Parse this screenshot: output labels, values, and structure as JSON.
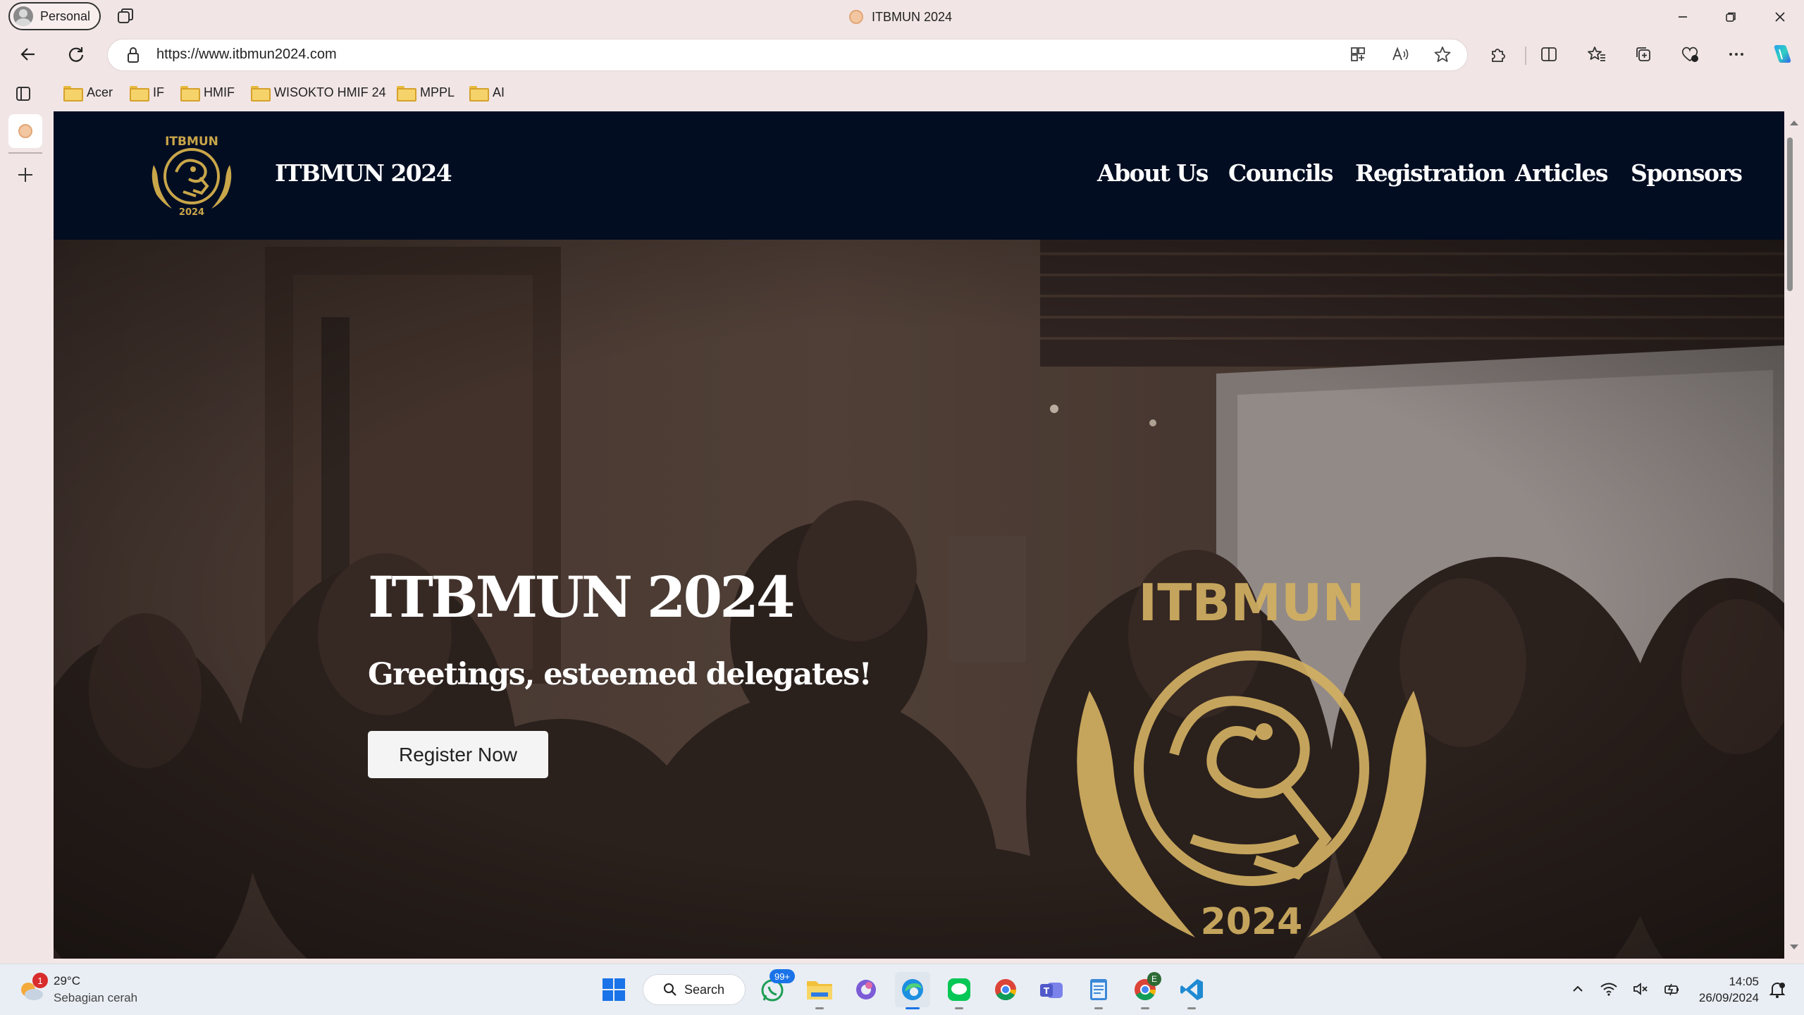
{
  "browser": {
    "profile_label": "Personal",
    "tab_title": "ITBMUN 2024",
    "url": "https://www.itbmun2024.com",
    "bookmarks": [
      {
        "label": "Acer"
      },
      {
        "label": "IF"
      },
      {
        "label": "HMIF"
      },
      {
        "label": "WISOKTO HMIF 24"
      },
      {
        "label": "MPPL"
      },
      {
        "label": "AI"
      }
    ]
  },
  "site": {
    "brand": "ITBMUN 2024",
    "nav": [
      "About Us",
      "Councils",
      "Registration",
      "Articles",
      "Sponsors"
    ],
    "hero": {
      "title": "ITBMUN 2024",
      "subtitle": "Greetings, esteemed delegates!",
      "cta": "Register Now"
    },
    "logo_text_top": "ITBMUN",
    "logo_text_bottom": "2024"
  },
  "taskbar": {
    "weather_temp": "29°C",
    "weather_desc": "Sebagian cerah",
    "weather_badge": "1",
    "search_label": "Search",
    "whatsapp_badge": "99+",
    "chrome_profile_badge": "E",
    "time": "14:05",
    "date": "26/09/2024"
  },
  "colors": {
    "nav_bg": "#020d22",
    "gold": "#c9a649",
    "browser_chrome": "#f1e5e5",
    "taskbar": "#e9eef4"
  }
}
